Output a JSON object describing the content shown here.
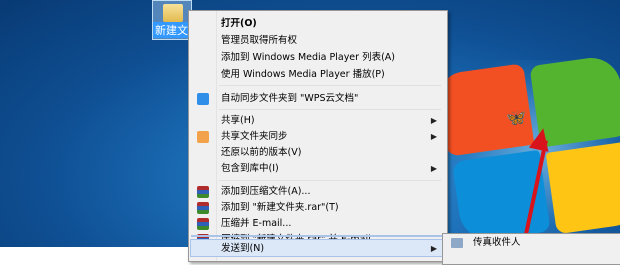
{
  "desktop": {
    "folder_label": "新建文件夹",
    "icons": {
      "folder": "folder-icon",
      "logo": "windows-logo",
      "butterfly": "butterfly-icon",
      "arrow": "red-arrow"
    },
    "colors": {
      "arrow": "#d8131b",
      "menu_bg": "#f0f0f0"
    }
  },
  "menu": {
    "items": [
      {
        "label": "打开(O)"
      },
      {
        "label": "管理员取得所有权"
      },
      {
        "label": "添加到 Windows Media Player 列表(A)"
      },
      {
        "label": "使用 Windows Media Player 播放(P)"
      },
      {
        "label": "自动同步文件夹到  \"WPS云文档\"",
        "icon": "cloud-sync-icon"
      },
      {
        "label": "共享(H)"
      },
      {
        "label": "共享文件夹同步",
        "icon": "folder-sync-icon"
      },
      {
        "label": "还原以前的版本(V)"
      },
      {
        "label": "包含到库中(I)"
      },
      {
        "label": "添加到压缩文件(A)...",
        "icon": "winrar-icon"
      },
      {
        "label": "添加到 \"新建文件夹.rar\"(T)",
        "icon": "winrar-icon"
      },
      {
        "label": "压缩并 E-mail...",
        "icon": "winrar-icon"
      },
      {
        "label": "压缩到 \"新建文件夹.rar\" 并 E-mail",
        "icon": "winrar-icon"
      },
      {
        "label": "发送到(N)"
      }
    ]
  },
  "submenu": {
    "items": [
      {
        "label": "传真收件人",
        "icon": "fax-icon"
      }
    ]
  }
}
